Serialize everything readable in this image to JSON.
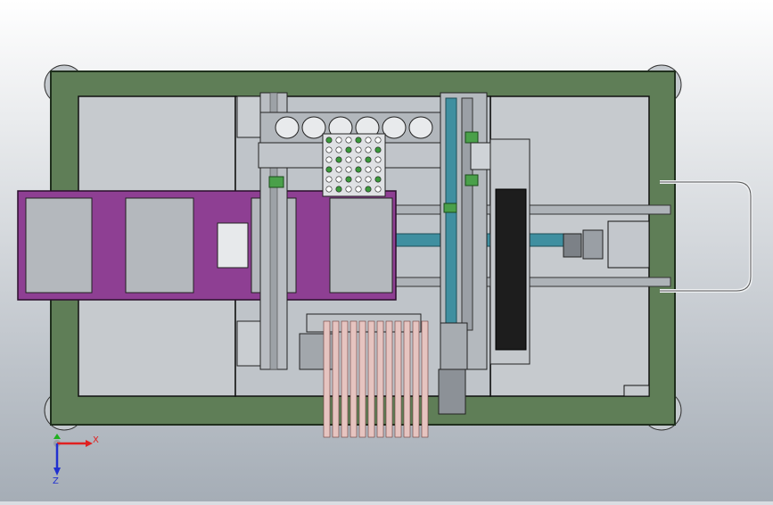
{
  "colors": {
    "background_top": "#ffffff",
    "background_bottom": "#9fa8b2",
    "frame_green": "#5b7a54",
    "frame_green_dark": "#2f4a2c",
    "panel_grey": "#c9cdd2",
    "purple_plate": "#8e3f93",
    "steel": "#b8bcc1",
    "rail": "#9ea3a8",
    "cyan_rod": "#3f8fa0",
    "pink_strip": "#e8c6c2",
    "dark_block": "#1c1c1c",
    "axis_x": "#e02020",
    "axis_y": "#20b020",
    "axis_z": "#2030d0"
  },
  "triad": {
    "x_label": "X",
    "z_label": "Z",
    "x_icon": "x-axis-arrow-icon",
    "y_icon": "y-axis-arrow-icon",
    "z_icon": "z-axis-arrow-icon"
  },
  "parts": {
    "gripper_holes": 6,
    "pink_strips": 12,
    "tray_grid_rows": 6,
    "tray_grid_cols": 6
  }
}
